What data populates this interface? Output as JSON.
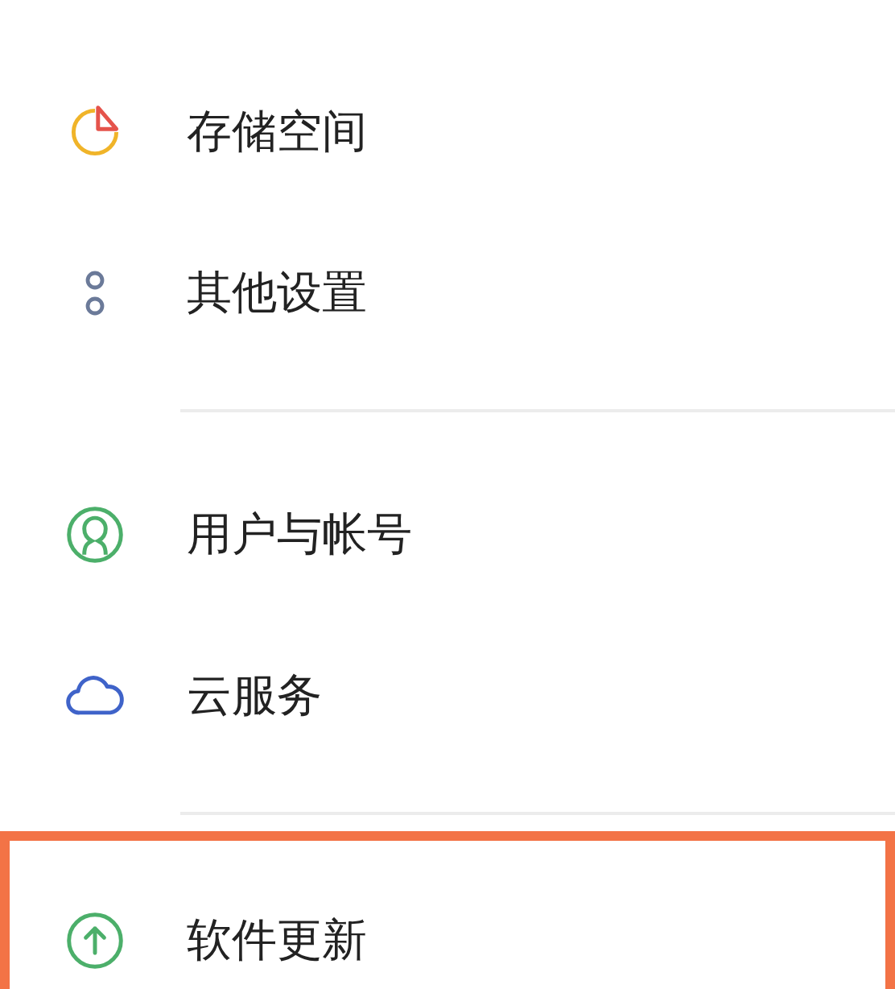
{
  "sections": [
    {
      "items": [
        {
          "label": "存储空间",
          "highlighted": false
        },
        {
          "label": "其他设置",
          "highlighted": false
        }
      ]
    },
    {
      "items": [
        {
          "label": "用户与帐号",
          "highlighted": false
        },
        {
          "label": "云服务",
          "highlighted": false
        }
      ]
    },
    {
      "items": [
        {
          "label": "软件更新",
          "highlighted": true
        }
      ]
    }
  ]
}
